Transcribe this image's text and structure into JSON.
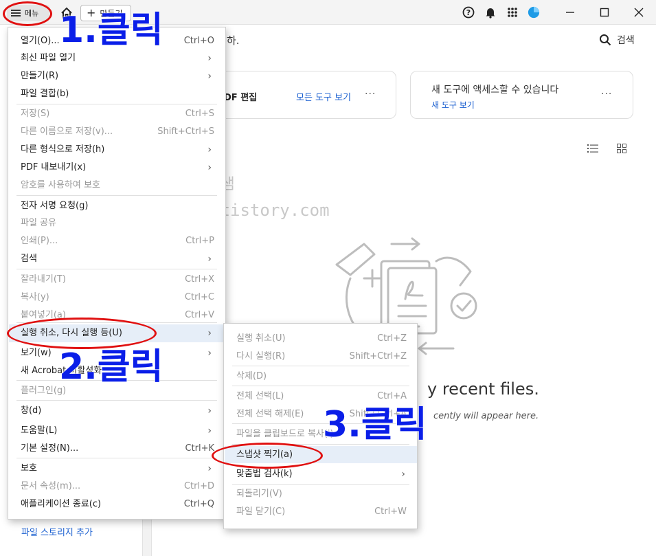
{
  "titlebar": {
    "menu_label": "메뉴",
    "create_label": "만들기"
  },
  "main": {
    "top_text": "하.",
    "search_label": "검색",
    "card1": {
      "title": "DF 편집",
      "link": "모든 도구 보기",
      "more": "···"
    },
    "card2": {
      "title": "새 도구에 액세스할 수 있습니다",
      "link": "새 도구 보기",
      "more": "···"
    },
    "recent_big": "y recent files.",
    "recent_small": "cently will appear here.",
    "storage_link": "파일 스토리지 추가"
  },
  "watermark": {
    "line1": "쉬운샘",
    "line2": "fervors.tistory.com"
  },
  "menu": {
    "items": [
      {
        "label": "열기(O)...",
        "shortcut": "Ctrl+O",
        "disabled": false,
        "submenu": false
      },
      {
        "label": "최신 파일 열기",
        "shortcut": "",
        "disabled": false,
        "submenu": true
      },
      {
        "label": "만들기(R)",
        "shortcut": "",
        "disabled": false,
        "submenu": true
      },
      {
        "label": "파일 결합(b)",
        "shortcut": "",
        "disabled": false,
        "submenu": false
      },
      {
        "label": "저장(S)",
        "shortcut": "Ctrl+S",
        "disabled": true,
        "submenu": false
      },
      {
        "label": "다른 이름으로 저장(v)...",
        "shortcut": "Shift+Ctrl+S",
        "disabled": true,
        "submenu": false
      },
      {
        "label": "다른 형식으로 저장(h)",
        "shortcut": "",
        "disabled": false,
        "submenu": true
      },
      {
        "label": "PDF 내보내기(x)",
        "shortcut": "",
        "disabled": false,
        "submenu": true
      },
      {
        "label": "암호를 사용하여 보호",
        "shortcut": "",
        "disabled": true,
        "submenu": false
      },
      {
        "label": "전자 서명 요청(g)",
        "shortcut": "",
        "disabled": false,
        "submenu": false
      },
      {
        "label": "파일 공유",
        "shortcut": "",
        "disabled": true,
        "submenu": false
      },
      {
        "label": "인쇄(P)...",
        "shortcut": "Ctrl+P",
        "disabled": true,
        "submenu": false
      },
      {
        "label": "검색",
        "shortcut": "",
        "disabled": false,
        "submenu": true
      },
      {
        "label": "잘라내기(T)",
        "shortcut": "Ctrl+X",
        "disabled": true,
        "submenu": false
      },
      {
        "label": "복사(y)",
        "shortcut": "Ctrl+C",
        "disabled": true,
        "submenu": false
      },
      {
        "label": "붙여넣기(a)",
        "shortcut": "Ctrl+V",
        "disabled": true,
        "submenu": false
      },
      {
        "label": "실행 취소, 다시 실행 등(U)",
        "shortcut": "",
        "disabled": false,
        "submenu": true
      },
      {
        "label": "보기(w)",
        "shortcut": "",
        "disabled": false,
        "submenu": true
      },
      {
        "label": "새 Acrobat 비활성화",
        "shortcut": "",
        "disabled": false,
        "submenu": false
      },
      {
        "label": "플러그인(g)",
        "shortcut": "",
        "disabled": true,
        "submenu": false
      },
      {
        "label": "창(d)",
        "shortcut": "",
        "disabled": false,
        "submenu": true
      },
      {
        "label": "도움말(L)",
        "shortcut": "",
        "disabled": false,
        "submenu": true
      },
      {
        "label": "기본 설정(N)...",
        "shortcut": "Ctrl+K",
        "disabled": false,
        "submenu": false
      },
      {
        "label": "보호",
        "shortcut": "",
        "disabled": false,
        "submenu": true
      },
      {
        "label": "문서 속성(m)...",
        "shortcut": "Ctrl+D",
        "disabled": true,
        "submenu": false
      },
      {
        "label": "애플리케이션 종료(c)",
        "shortcut": "Ctrl+Q",
        "disabled": false,
        "submenu": false
      }
    ]
  },
  "submenu": {
    "items": [
      {
        "label": "실행 취소(U)",
        "shortcut": "Ctrl+Z",
        "disabled": true,
        "submenu": false
      },
      {
        "label": "다시 실행(R)",
        "shortcut": "Shift+Ctrl+Z",
        "disabled": true,
        "submenu": false
      },
      {
        "label": "삭제(D)",
        "shortcut": "",
        "disabled": true,
        "submenu": false
      },
      {
        "label": "전체 선택(L)",
        "shortcut": "Ctrl+A",
        "disabled": true,
        "submenu": false
      },
      {
        "label": "전체 선택 해제(E)",
        "shortcut": "Shift+Ctrl+A",
        "disabled": true,
        "submenu": false
      },
      {
        "label": "파일을 클립보드로 복사(i)",
        "shortcut": "",
        "disabled": true,
        "submenu": false
      },
      {
        "label": "스냅샷 찍기(a)",
        "shortcut": "",
        "disabled": false,
        "submenu": false
      },
      {
        "label": "맞춤법 검사(k)",
        "shortcut": "",
        "disabled": false,
        "submenu": true
      },
      {
        "label": "되돌리기(V)",
        "shortcut": "",
        "disabled": true,
        "submenu": false
      },
      {
        "label": "파일 닫기(C)",
        "shortcut": "Ctrl+W",
        "disabled": true,
        "submenu": false
      }
    ]
  },
  "annotations": {
    "step1": "1.클릭",
    "step2": "2.클릭",
    "step3": "3.클릭",
    "oval_color": "#e01010",
    "text_color": "#0a1ee8"
  }
}
